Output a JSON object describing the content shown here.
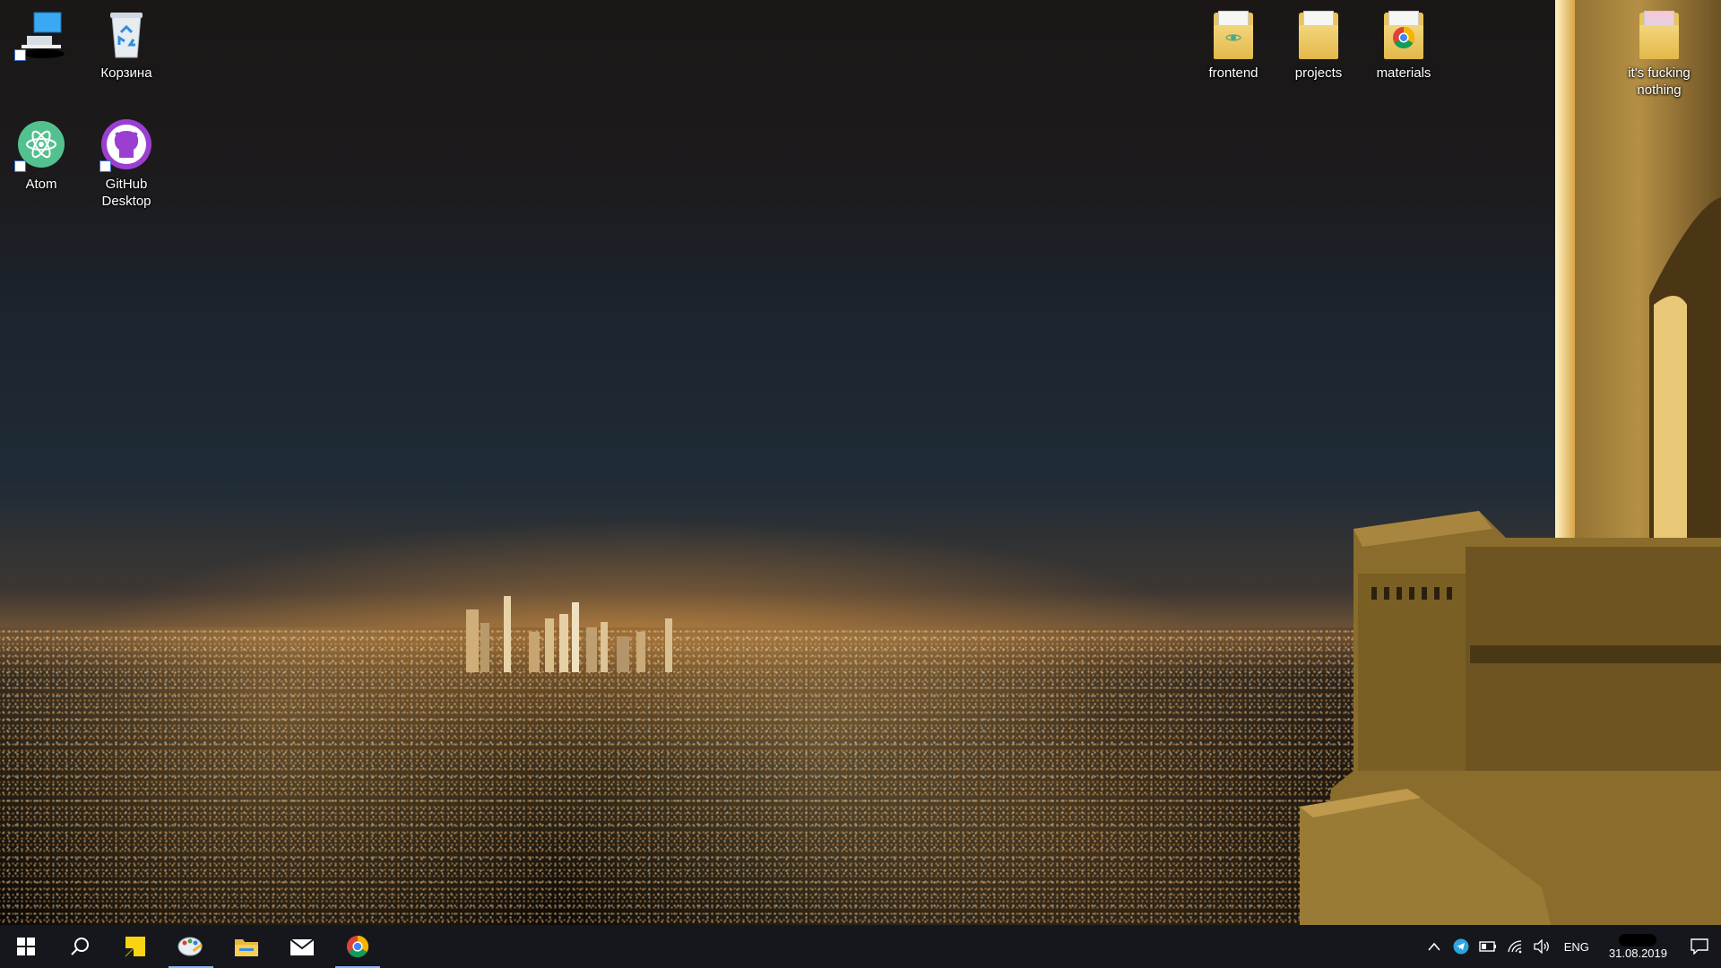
{
  "desktop": {
    "icons_left": [
      {
        "id": "this-pc",
        "label": "",
        "icon": "computer-icon"
      },
      {
        "id": "recycle-bin",
        "label": "Корзина",
        "icon": "recycle-bin-icon"
      },
      {
        "id": "atom",
        "label": "Atom",
        "icon": "atom-icon"
      },
      {
        "id": "github-desktop",
        "label": "GitHub\nDesktop",
        "icon": "github-icon"
      }
    ],
    "icons_right": [
      {
        "id": "frontend",
        "label": "frontend",
        "icon": "folder-icon"
      },
      {
        "id": "projects",
        "label": "projects",
        "icon": "folder-icon"
      },
      {
        "id": "materials",
        "label": "materials",
        "icon": "folder-chrome-icon"
      },
      {
        "id": "nothing",
        "label": "it's fucking\nnothing",
        "icon": "folder-icon"
      }
    ]
  },
  "taskbar": {
    "apps": [
      {
        "id": "start",
        "icon": "windows-icon",
        "active": false
      },
      {
        "id": "search",
        "icon": "search-icon",
        "active": false
      },
      {
        "id": "sticky-notes",
        "icon": "sticky-notes-icon",
        "active": false
      },
      {
        "id": "paint",
        "icon": "paint-icon",
        "active": true
      },
      {
        "id": "file-explorer",
        "icon": "folder-icon",
        "active": false
      },
      {
        "id": "mail",
        "icon": "mail-icon",
        "active": false
      },
      {
        "id": "chrome",
        "icon": "chrome-icon",
        "active": true
      }
    ],
    "tray": {
      "language": "ENG",
      "date": "31.08.2019"
    }
  },
  "colors": {
    "taskbar_bg": "#15171c",
    "active_indicator": "#8ab4f8",
    "folder_yellow": "#e9c45c"
  }
}
